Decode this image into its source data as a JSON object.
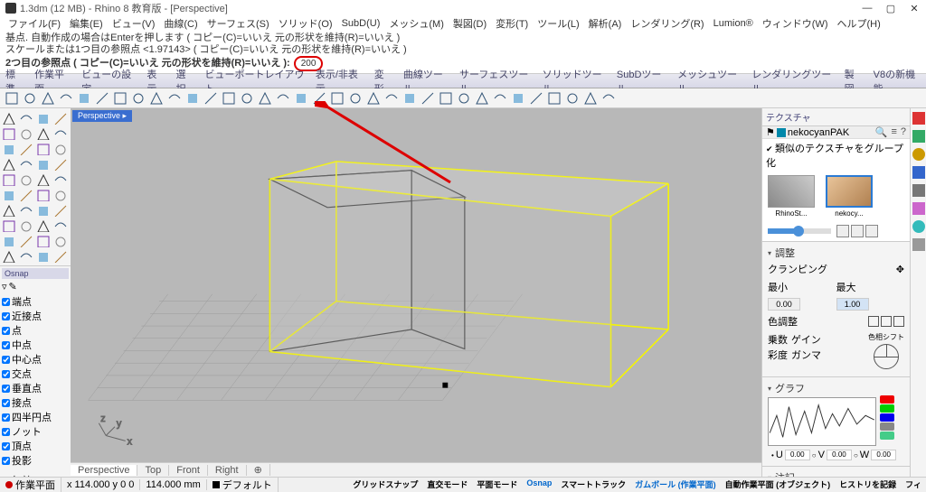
{
  "title": "1.3dm (12 MB) - Rhino 8 教育版 - [Perspective]",
  "menu": [
    "ファイル(F)",
    "編集(E)",
    "ビュー(V)",
    "曲線(C)",
    "サーフェス(S)",
    "ソリッド(O)",
    "SubD(U)",
    "メッシュ(M)",
    "製図(D)",
    "変形(T)",
    "ツール(L)",
    "解析(A)",
    "レンダリング(R)",
    "Lumion®",
    "ウィンドウ(W)",
    "ヘルプ(H)"
  ],
  "cmd_history": [
    "基点. 自動作成の場合はEnterを押します ( コピー(C)=いいえ  元の形状を維持(R)=いいえ )",
    "スケールまたは1つ目の参照点 <1.97143> ( コピー(C)=いいえ  元の形状を維持(R)=いいえ )"
  ],
  "cmd_prompt": "2つ目の参照点 ( コピー(C)=いいえ  元の形状を維持(R)=いいえ ):",
  "cmd_input": "200",
  "panel_tabs": [
    "標準",
    "作業平面",
    "ビューの設定",
    "表示",
    "選択",
    "ビューポートレイアウト",
    "表示/非表示",
    "変形",
    "曲線ツール",
    "サーフェスツール",
    "ソリッドツール",
    "SubDツール",
    "メッシュツール",
    "レンダリングツール",
    "製図",
    "V8の新機能"
  ],
  "viewport_label": "Perspective ▸",
  "viewport_tabs": [
    "Perspective",
    "Top",
    "Front",
    "Right"
  ],
  "osnap": {
    "header": "Osnap",
    "items": [
      "端点",
      "近接点",
      "点",
      "中点",
      "中心点",
      "交点",
      "垂直点",
      "接点",
      "四半円点",
      "ノット",
      "頂点",
      "投影"
    ],
    "disabled": "無効"
  },
  "right": {
    "title": "テクスチャ",
    "lib": "nekocyanPAK",
    "group_label": "類似のテクスチャをグループ化",
    "thumbs": [
      "RhinoSt...",
      "nekocy..."
    ],
    "adjust": "調整",
    "clamping": "クランピング",
    "min": "最小",
    "max": "最大",
    "minv": "0.00",
    "maxv": "1.00",
    "color_adj": "色調整",
    "mult": "乗数",
    "gain": "ゲイン",
    "hue": "色相シフト",
    "sat": "彩度",
    "gamma": "ガンマ",
    "graph": "グラフ",
    "notes": "注記",
    "u": "U",
    "v": "V",
    "w": "W",
    "uval": "0.00",
    "vval": "0.00",
    "wval": "0.00"
  },
  "status": {
    "cplane": "作業平面",
    "coord": "x 114.000  y 0  0",
    "dist": "114.000 mm",
    "layer": "デフォルト",
    "toggles": [
      "グリッドスナップ",
      "直交モード",
      "平面モード",
      "Osnap",
      "スマートトラック",
      "ガムボール (作業平面)",
      "自動作業平面 (オブジェクト)",
      "ヒストリを記録",
      "フィ"
    ]
  }
}
